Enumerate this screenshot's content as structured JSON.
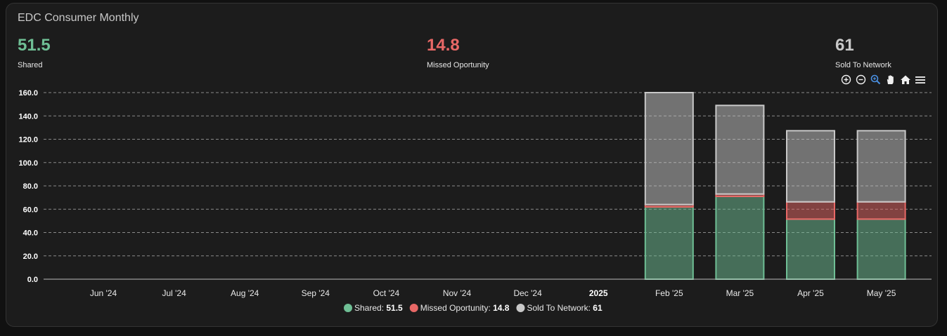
{
  "card": {
    "title": "EDC Consumer Monthly"
  },
  "stats": [
    {
      "value": "51.5",
      "label": "Shared",
      "color": "#6fbf95"
    },
    {
      "value": "14.8",
      "label": "Missed Oportunity",
      "color": "#e86866"
    },
    {
      "value": "61",
      "label": "Sold To Network",
      "color": "#c8c8c8"
    }
  ],
  "toolbar": {
    "icons": [
      "zoom-in-icon",
      "zoom-out-icon",
      "zoom-selection-icon",
      "pan-hand-icon",
      "home-reset-icon",
      "menu-icon"
    ],
    "active_color": "#4a90e2",
    "icon_color": "#f0f0f0"
  },
  "legend": {
    "items": [
      {
        "name": "Shared",
        "value": "51.5",
        "color": "#6fbf95"
      },
      {
        "name": "Missed Oportunity",
        "value": "14.8",
        "color": "#e86866"
      },
      {
        "name": "Sold To Network",
        "value": "61",
        "color": "#c8c8c8"
      }
    ]
  },
  "chart_data": {
    "type": "bar",
    "stacked": true,
    "x_tick_labels": [
      "Jun '24",
      "Jul '24",
      "Aug '24",
      "Sep '24",
      "Oct '24",
      "Nov '24",
      "Dec '24",
      "2025",
      "Feb '25",
      "Mar '25",
      "Apr '25",
      "May '25"
    ],
    "bold_tick_labels": [
      "2025"
    ],
    "categories": [
      "Feb '25",
      "Mar '25",
      "Apr '25",
      "May '25"
    ],
    "series": [
      {
        "name": "Shared",
        "values": [
          62,
          71,
          51.5,
          51.5
        ],
        "color": "#6fbf95"
      },
      {
        "name": "Missed Oportunity",
        "values": [
          2,
          2,
          14.8,
          14.8
        ],
        "color": "#e86866"
      },
      {
        "name": "Sold To Network",
        "values": [
          96,
          76,
          61,
          61
        ],
        "color": "#c8c8c8"
      }
    ],
    "y_ticks": [
      "0.0",
      "20.0",
      "40.0",
      "60.0",
      "80.0",
      "100.0",
      "120.0",
      "140.0",
      "160.0"
    ],
    "ylim": [
      0,
      160
    ],
    "grid": true,
    "legend_position": "bottom"
  }
}
